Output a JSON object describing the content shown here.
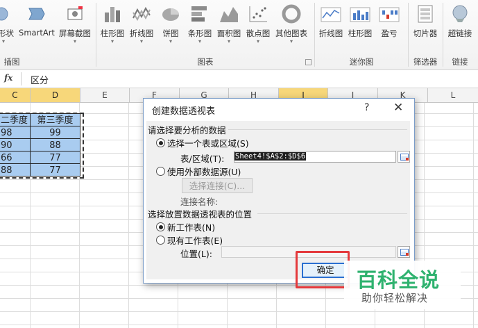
{
  "ribbon": {
    "buttons": [
      {
        "label": "形状",
        "icon": "shapes-icon"
      },
      {
        "label": "SmartArt",
        "icon": "smartart-icon"
      },
      {
        "label": "屏幕截图",
        "icon": "screenshot-icon"
      },
      {
        "label": "柱形图",
        "icon": "column-chart-icon"
      },
      {
        "label": "折线图",
        "icon": "line-chart-icon"
      },
      {
        "label": "饼图",
        "icon": "pie-chart-icon"
      },
      {
        "label": "条形图",
        "icon": "bar-chart-icon"
      },
      {
        "label": "面积图",
        "icon": "area-chart-icon"
      },
      {
        "label": "散点图",
        "icon": "scatter-chart-icon"
      },
      {
        "label": "其他图表",
        "icon": "other-chart-icon"
      },
      {
        "label": "折线图",
        "icon": "sparkline-line-icon"
      },
      {
        "label": "柱形图",
        "icon": "sparkline-column-icon"
      },
      {
        "label": "盈亏",
        "icon": "sparkline-winloss-icon"
      },
      {
        "label": "切片器",
        "icon": "slicer-icon"
      },
      {
        "label": "超链接",
        "icon": "hyperlink-icon"
      }
    ],
    "groups": [
      "插图",
      "图表",
      "迷你图",
      "筛选器",
      "链接"
    ]
  },
  "formula_bar": {
    "fx": "fx",
    "content": "区分"
  },
  "columns": [
    "C",
    "D",
    "E",
    "F",
    "G",
    "H",
    "I",
    "J",
    "K",
    "L"
  ],
  "sheet": {
    "rows": [
      [
        "二季度",
        "第三季度"
      ],
      [
        "98",
        "99"
      ],
      [
        "90",
        "88"
      ],
      [
        "66",
        "77"
      ],
      [
        "88",
        "77"
      ]
    ]
  },
  "dialog": {
    "title": "创建数据透视表",
    "help": "?",
    "close": "✕",
    "section1": "请选择要分析的数据",
    "opt_range": "选择一个表或区域(S)",
    "range_label": "表/区域(T):",
    "range_value": "Sheet4!$A$2:$D$6",
    "opt_external": "使用外部数据源(U)",
    "choose_conn": "选择连接(C)...",
    "conn_name": "连接名称:",
    "section2": "选择放置数据透视表的位置",
    "opt_new": "新工作表(N)",
    "opt_existing": "现有工作表(E)",
    "location_label": "位置(L):",
    "location_value": "",
    "ok": "确定"
  },
  "watermark": {
    "title": "百科全说",
    "subtitle": "助你轻松解决"
  }
}
